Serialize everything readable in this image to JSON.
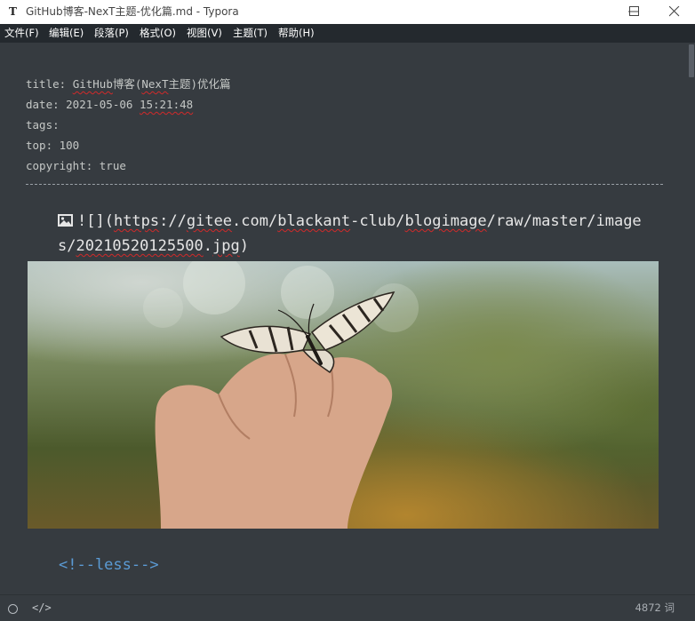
{
  "window": {
    "title": "GitHub博客-NexT主题-优化篇.md - Typora",
    "app_icon_letter": "T",
    "controls": [
      "minimize-icon",
      "maximize-icon",
      "close-icon"
    ]
  },
  "menu": {
    "items": [
      "文件(F)",
      "编辑(E)",
      "段落(P)",
      "格式(O)",
      "视图(V)",
      "主题(T)",
      "帮助(H)"
    ]
  },
  "front_matter": {
    "title": {
      "key": "title: ",
      "value_a": "GitHub",
      "value_b": "博客(",
      "value_c": "NexT",
      "value_d": "主题)优化篇"
    },
    "date": {
      "key": "date: ",
      "value_a": "2021-05-06 ",
      "value_b": "15:21:48"
    },
    "tags": "tags:",
    "top": "top: 100",
    "copyright": "copyright: true"
  },
  "image_block": {
    "icon": "image-icon",
    "line1_a": "![](",
    "line1_b": "https",
    "line1_c": "://",
    "line1_d": "gitee",
    "line1_e": ".com/",
    "line1_f": "blackant",
    "line1_g": "-club/",
    "line1_h": "blogimage",
    "line1_i": "/raw/master/image",
    "line2_a": "s/",
    "line2_b": "20210520125500",
    "line2_c": ".",
    "line2_d": "jpg",
    "line2_e": ")"
  },
  "comment": "<!--less-->",
  "status": {
    "word_count": "4872 词",
    "code_toggle": "</>",
    "outline_icon": "circle-icon"
  },
  "colors": {
    "editor_bg": "#363b40",
    "menubar_bg": "#24292e",
    "comment": "#5b9bd5",
    "spell_error": "#d12a2a"
  }
}
